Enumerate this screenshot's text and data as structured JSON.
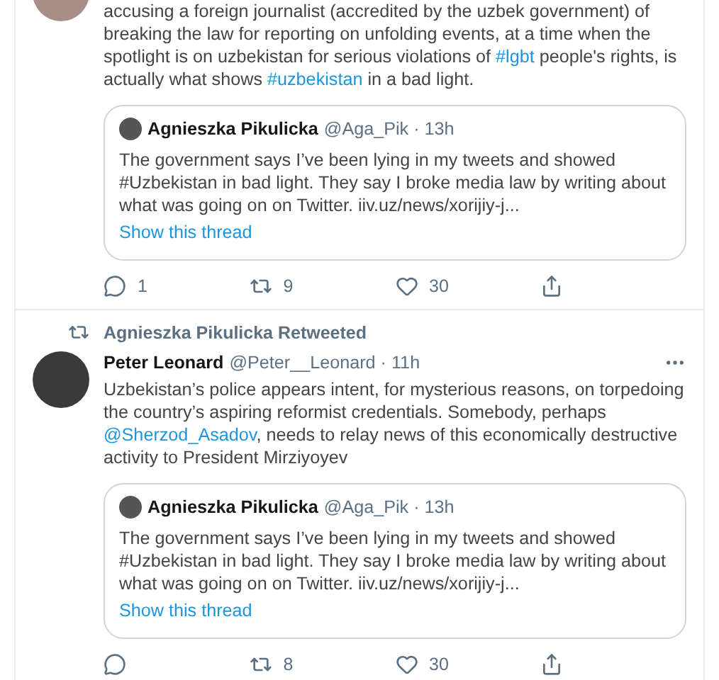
{
  "tweets": [
    {
      "body": [
        {
          "kind": "text",
          "text": "accusing a foreign journalist (accredited by the uzbek government) of breaking the law for reporting on unfolding events, at a time when the spotlight is on uzbekistan for serious violations of "
        },
        {
          "kind": "link",
          "text": "#lgbt"
        },
        {
          "kind": "text",
          "text": " people's rights, is actually what shows "
        },
        {
          "kind": "link",
          "text": "#uzbekistan"
        },
        {
          "kind": "text",
          "text": " in a bad light."
        }
      ],
      "quote": {
        "author": "Agnieszka Pikulicka",
        "handle": "@Aga_Pik · 13h",
        "text": "The government says I’ve been lying in my tweets and showed #Uzbekistan in bad light. They say I broke media law by writing about what was going on on Twitter. iiv.uz/news/xorijiy-j...",
        "link": "Show this thread"
      },
      "actions": [
        {
          "kind": "reply",
          "count": "1"
        },
        {
          "kind": "retweet",
          "count": "9"
        },
        {
          "kind": "like",
          "count": "30"
        },
        {
          "kind": "share"
        }
      ]
    },
    {
      "social_context": "Agnieszka Pikulicka Retweeted",
      "author": "Peter Leonard",
      "handle": "@Peter__Leonard · 11h",
      "more": true,
      "body": [
        {
          "kind": "text",
          "text": "Uzbekistan’s police appears intent, for mysterious reasons, on torpedoing the country’s aspiring reformist credentials.  Somebody, perhaps "
        },
        {
          "kind": "link",
          "text": "@Sherzod_Asadov"
        },
        {
          "kind": "text",
          "text": ", needs to relay news of this economically destructive activity to President Mirziyoyev"
        }
      ],
      "quote": {
        "author": "Agnieszka Pikulicka",
        "handle": "@Aga_Pik · 13h",
        "text": "The government says I’ve been lying in my tweets and showed #Uzbekistan in bad light. They say I broke media law by writing about what was going on on Twitter. iiv.uz/news/xorijiy-j...",
        "link": "Show this thread"
      },
      "actions": [
        {
          "kind": "reply"
        },
        {
          "kind": "retweet",
          "count": "8"
        },
        {
          "kind": "like",
          "count": "30"
        },
        {
          "kind": "share"
        }
      ]
    }
  ]
}
